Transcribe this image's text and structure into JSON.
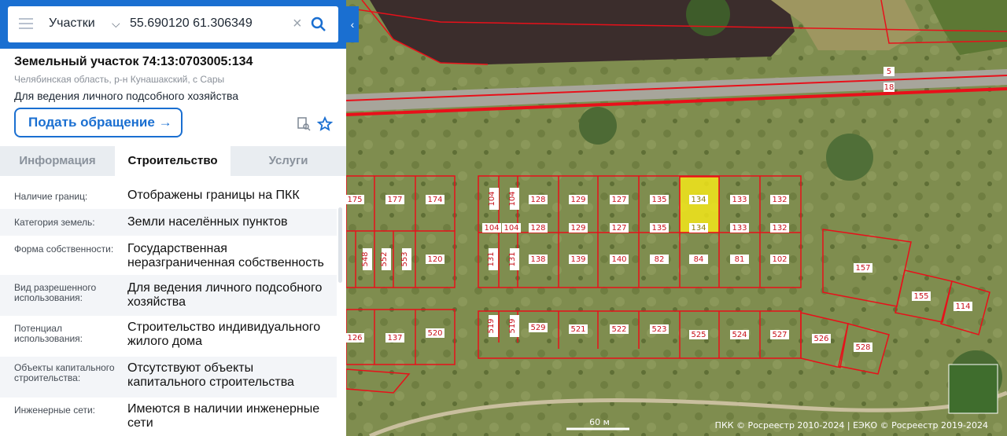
{
  "search": {
    "layer": "Участки",
    "query": "55.690120 61.306349",
    "clear_icon": "close-icon",
    "search_icon": "search-icon"
  },
  "parcel": {
    "title": "Земельный участок 74:13:0703005:134",
    "address": "Челябинская область, р-н Кунашакский, с Сары",
    "use": "Для ведения личного подсобного хозяйства",
    "appeal_label": "Подать обращение"
  },
  "tabs": [
    "Информация",
    "Строительство",
    "Услуги"
  ],
  "active_tab": 1,
  "rows": [
    {
      "key": "Наличие границ:",
      "value": "Отображены границы на ПКК"
    },
    {
      "key": "Категория земель:",
      "value": "Земли населённых пунктов"
    },
    {
      "key": "Форма собственности:",
      "value": "Государственная неразграниченная собственность"
    },
    {
      "key": "Вид разрешенного использования:",
      "value": "Для ведения личного подсобного хозяйства"
    },
    {
      "key": "Потенциал использования:",
      "value": "Строительство индивидуального жилого дома"
    },
    {
      "key": "Объекты капитального строительства:",
      "value": "Отсутствуют объекты капитального строительства"
    },
    {
      "key": "Инженерные сети:",
      "value": "Имеются в наличии инженерные сети"
    }
  ],
  "map": {
    "highlight_color": "#f2e61a",
    "boundary_color": "#e8101a",
    "scale_label": "60 м",
    "attribution": "ПКК © Росреестр 2010-2024 | ЕЭКО © Росреестр 2019-2024",
    "road_labels": [
      "5",
      "18"
    ],
    "parcels_row1": [
      "175",
      "177",
      "174",
      "104",
      "104",
      "128",
      "129",
      "127",
      "135",
      "134",
      "133",
      "132"
    ],
    "parcels_row1b": [
      "104",
      "104",
      "128",
      "129",
      "127",
      "135",
      "134",
      "133",
      "132"
    ],
    "parcels_row2": [
      "548",
      "552",
      "553",
      "120",
      "131",
      "131",
      "138",
      "139",
      "140",
      "82",
      "84",
      "81",
      "102",
      "157"
    ],
    "parcels_row3": [
      "126",
      "137",
      "520",
      "519",
      "519",
      "529",
      "521",
      "522",
      "523",
      "525",
      "524",
      "527",
      "526",
      "528",
      "155",
      "114"
    ]
  }
}
